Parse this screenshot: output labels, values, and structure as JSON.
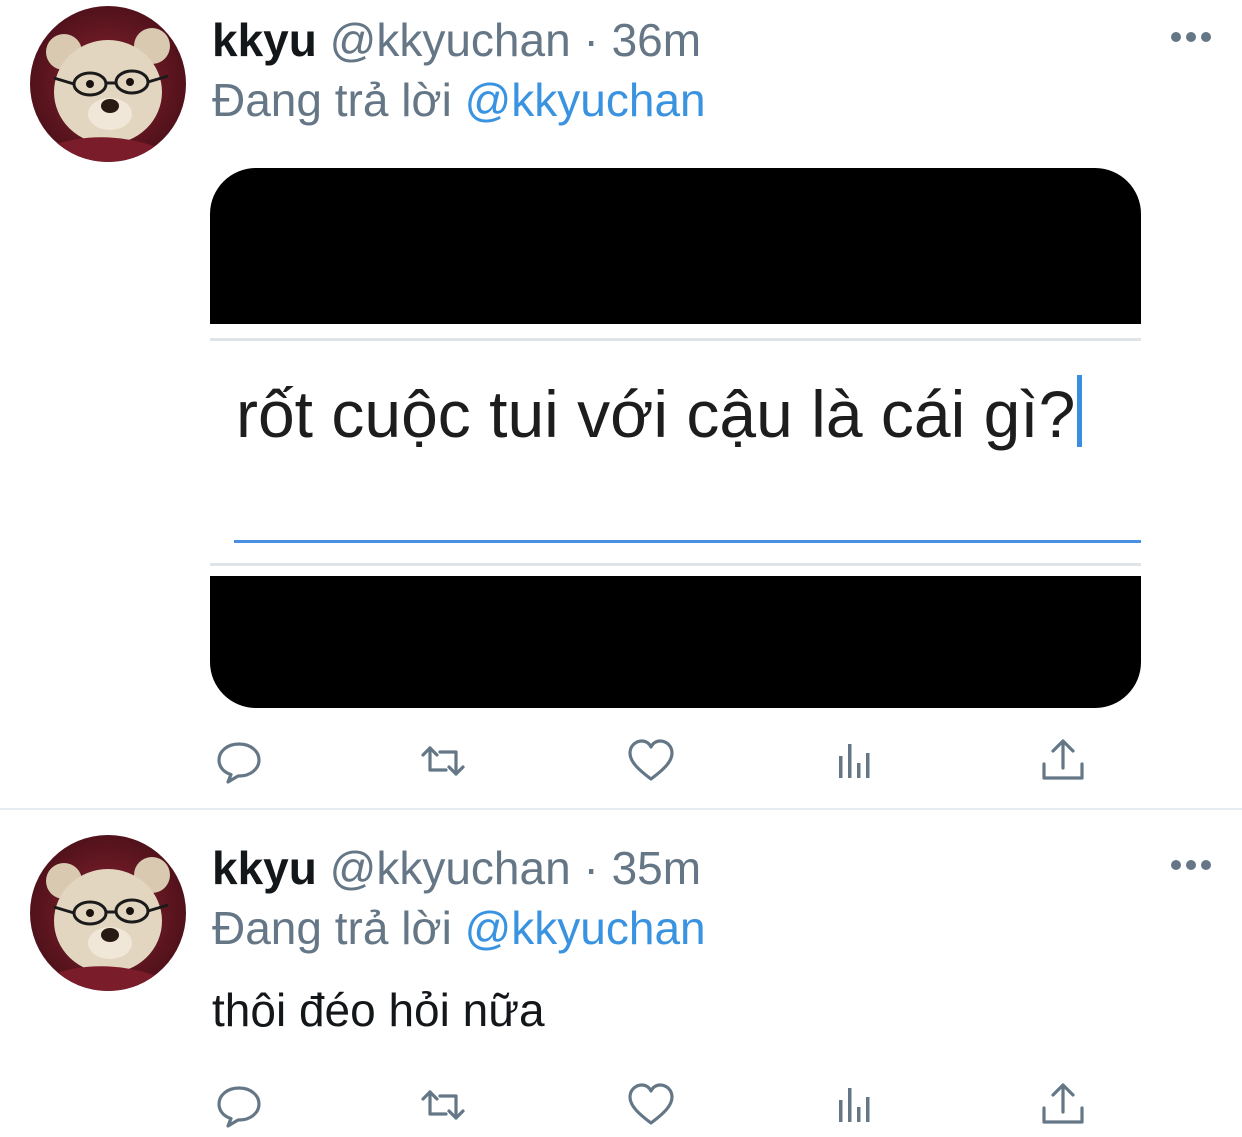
{
  "tweets": [
    {
      "name": "kkyu",
      "handle": "@kkyuchan",
      "separator": "·",
      "time": "36m",
      "reply_prefix": "Đang trả lời",
      "reply_to": "@kkyuchan",
      "media_text": "rốt cuộc tui với cậu là cái gì?"
    },
    {
      "name": "kkyu",
      "handle": "@kkyuchan",
      "separator": "·",
      "time": "35m",
      "reply_prefix": "Đang trả lời",
      "reply_to": "@kkyuchan",
      "text": "thôi đéo hỏi nữa"
    }
  ],
  "actions": [
    "reply-icon",
    "retweet-icon",
    "like-icon",
    "analytics-icon",
    "share-icon"
  ],
  "colors": {
    "link": "#3a93e0",
    "secondary_text": "#657786",
    "icon": "#657786",
    "divider": "#e6ecf0"
  }
}
